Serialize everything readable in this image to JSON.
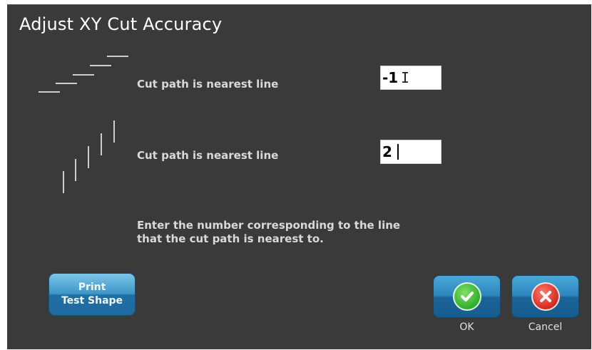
{
  "dialog": {
    "title": "Adjust XY Cut Accuracy",
    "x_row": {
      "label": "Cut path is nearest line",
      "value": "-1"
    },
    "y_row": {
      "label": "Cut path is nearest line",
      "value": "2"
    },
    "instructions": [
      "Enter the number corresponding to the line",
      "that the cut path is nearest to."
    ],
    "buttons": {
      "print_line1": "Print",
      "print_line2": "Test Shape",
      "ok_label": "OK",
      "cancel_label": "Cancel"
    }
  },
  "colors": {
    "dialog_background": "#3a3a3a",
    "button_blue": "#2b86bd",
    "ok_green": "#2fae2a",
    "cancel_red": "#d42a1f"
  }
}
